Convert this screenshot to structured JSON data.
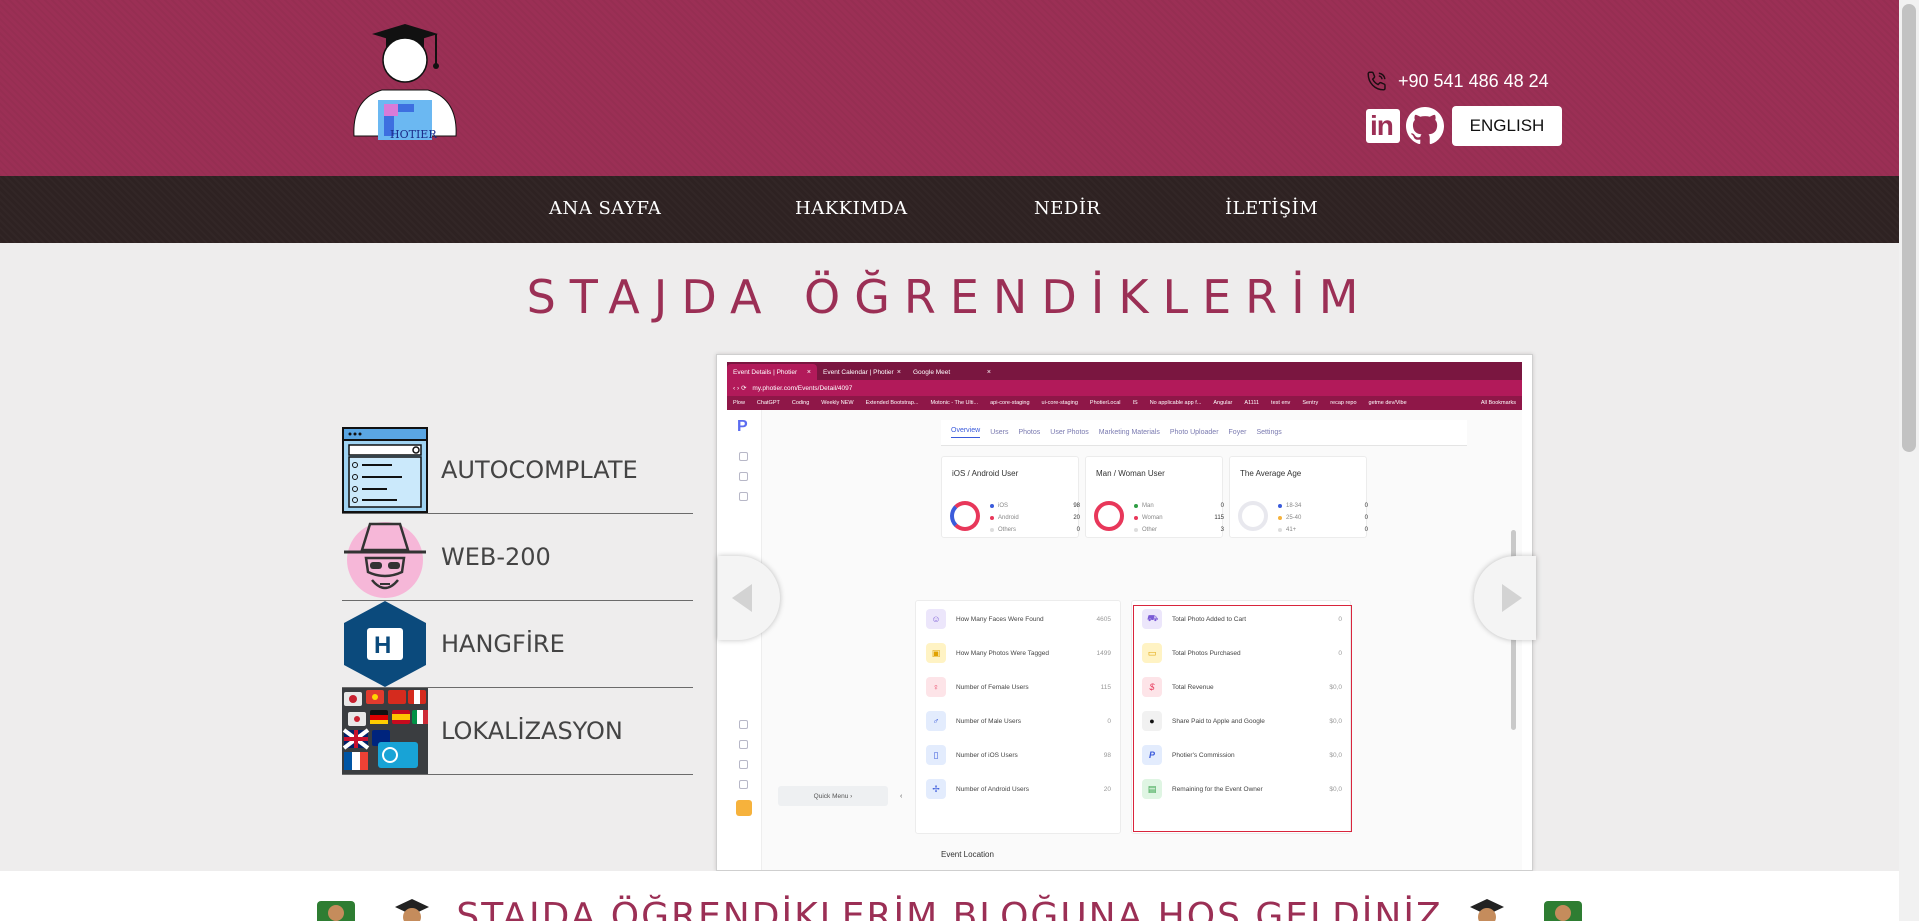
{
  "header": {
    "logo_text": "HOTIER",
    "phone": "+90 541 486 48 24",
    "linkedin_text": "in",
    "language_button": "ENGLISH"
  },
  "nav": {
    "items": [
      "ANA SAYFA",
      "HAKKIMDA",
      "NEDİR",
      "İLETİŞİM"
    ]
  },
  "main": {
    "title": "STAJDA ÖĞRENDİKLERİM",
    "topics": [
      "AUTOCOMPLATE",
      "WEB-200",
      "HANGFİRE",
      "LOKALİZASYON"
    ]
  },
  "slider": {
    "browser": {
      "tabs": [
        "Event Details | Photier",
        "Event Calendar | Photier",
        "Google Meet"
      ],
      "url": "my.photier.com/Events/Detail/4097",
      "bookmarks": [
        "Plow",
        "ChatGPT",
        "Coding",
        "Weekly NEW",
        "Extended Bootstrap...",
        "Motonic - The Ulti...",
        "api-core-staging",
        "ui-core-staging",
        "PhotierLocal",
        "IS",
        "No applicable app f...",
        "Angular",
        "A1111",
        "test env",
        "Sentry",
        "recap repo",
        "getme dev/Vibe"
      ],
      "bookmarks_right": "All Bookmarks"
    },
    "app": {
      "logo": "P",
      "tabs": [
        "Overview",
        "Users",
        "Photos",
        "User Photos",
        "Marketing Materials",
        "Photo Uploader",
        "Foyer",
        "Settings"
      ],
      "cards": [
        {
          "title": "iOS / Android User",
          "legend": [
            [
              "iOS",
              "98"
            ],
            [
              "Android",
              "20"
            ],
            [
              "Others",
              "0"
            ]
          ]
        },
        {
          "title": "Man / Woman User",
          "legend": [
            [
              "Man",
              "0"
            ],
            [
              "Woman",
              "115"
            ],
            [
              "Other",
              "3"
            ]
          ]
        },
        {
          "title": "The Average Age",
          "legend": [
            [
              "18-34",
              "0"
            ],
            [
              "25-40",
              "0"
            ],
            [
              "41+",
              "0"
            ]
          ]
        }
      ],
      "stats_left": [
        [
          "How Many Faces Were Found",
          "4605"
        ],
        [
          "How Many Photos Were Tagged",
          "1499"
        ],
        [
          "Number of Female Users",
          "115"
        ],
        [
          "Number of Male Users",
          "0"
        ],
        [
          "Number of iOS Users",
          "98"
        ],
        [
          "Number of Android Users",
          "20"
        ]
      ],
      "stats_right": [
        [
          "Total Photo Added to Cart",
          "0"
        ],
        [
          "Total Photos Purchased",
          "0"
        ],
        [
          "Total Revenue",
          "$0,0"
        ],
        [
          "Share Paid to Apple and Google",
          "$0,0"
        ],
        [
          "Photier's Commission",
          "$0,0"
        ],
        [
          "Remaining for the Event Owner",
          "$0,0"
        ]
      ],
      "quick_menu": "Quick Menu ›",
      "quick_toggle": "‹",
      "event_location": "Event Location"
    }
  },
  "welcome": {
    "text": "STAJDA ÖĞRENDİKLERİM BLOĞUNA HOŞ GELDİNİZ"
  },
  "colors": {
    "brand": "#9b2f55",
    "nav_bg": "#2e2222",
    "page_bg": "#eeeded"
  }
}
